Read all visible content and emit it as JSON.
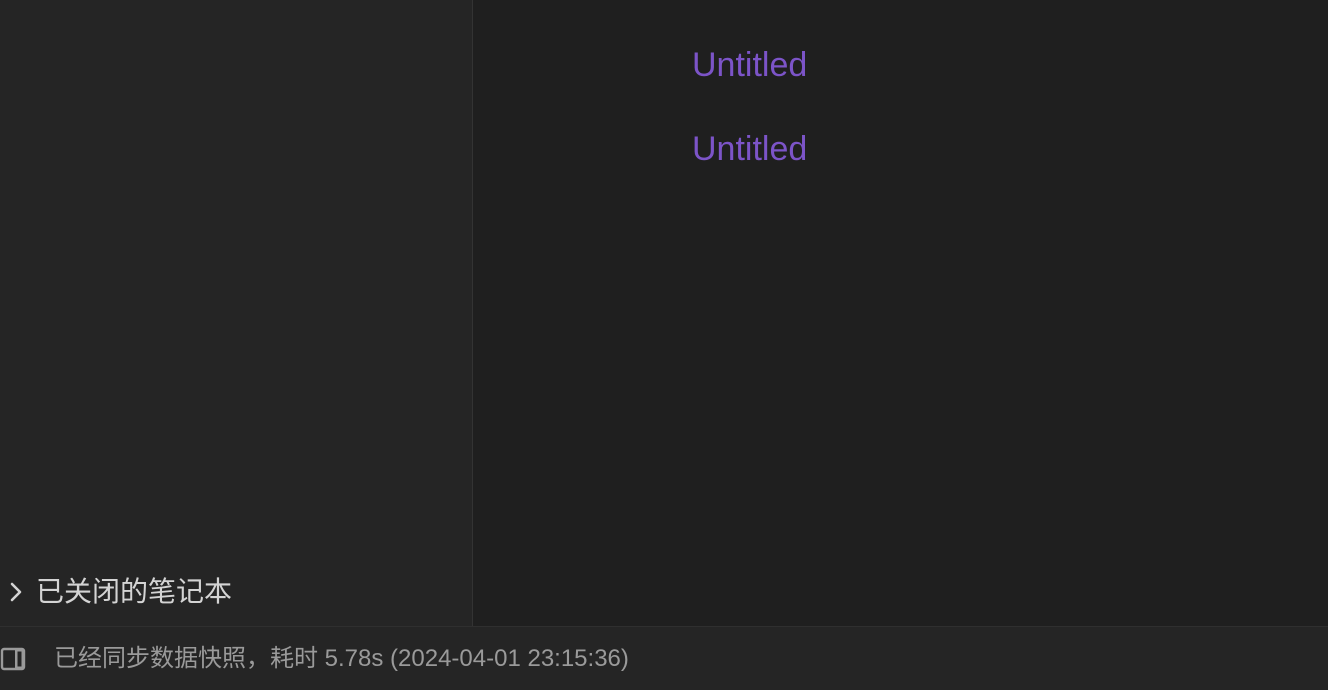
{
  "sidebar": {
    "closed_notebooks_label": "已关闭的笔记本",
    "chevron_icon": "chevron-right-icon"
  },
  "editor": {
    "block_refs": [
      {
        "label": "Untitled"
      },
      {
        "label": "Untitled"
      }
    ],
    "link_color": "#7c54c8"
  },
  "statusbar": {
    "dock_icon": "dock-toggle-icon",
    "message": "已经同步数据快照，耗时 5.78s (2024-04-01 23:15:36)"
  }
}
